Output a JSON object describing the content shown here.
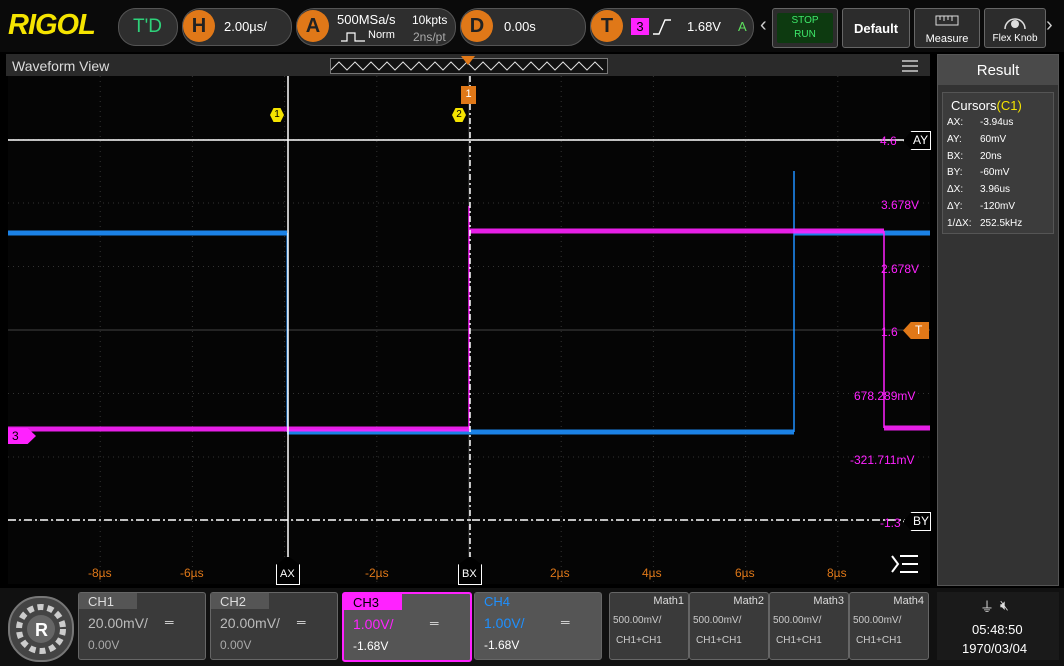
{
  "brand": {
    "logo": "RIGOL"
  },
  "topbar": {
    "trigger_mode": "T'D",
    "horizontal": {
      "icon": "H",
      "value": "2.00µs/"
    },
    "acquire": {
      "icon": "A",
      "sample_rate": "500MSa/s",
      "mode": "Norm",
      "points": "10kpts",
      "per_pt": "2ns/pt"
    },
    "delay": {
      "icon": "D",
      "value": "0.00s"
    },
    "trigger": {
      "icon": "T",
      "channel": "3",
      "level": "1.68V",
      "status": "A"
    },
    "stop_run": {
      "line1": "STOP",
      "line2": "RUN"
    },
    "default_label": "Default",
    "measure_label": "Measure",
    "flex_knob_label": "Flex Knob"
  },
  "waveform": {
    "title": "Waveform View",
    "cursor_ay_label": "AY",
    "cursor_by_label": "BY",
    "cursor_ax_label": "AX",
    "cursor_bx_label": "BX",
    "trigger_marker": "T",
    "ch3_marker": "3",
    "ay_value": "4.6",
    "by_value": "-1.3",
    "t_value": "1.6",
    "marker1": "1",
    "marker2": "2",
    "voltage_labels": [
      "3.678V",
      "2.678V",
      "678.289mV",
      "-321.711mV"
    ],
    "time_labels": [
      "-8µs",
      "-6µs",
      "-2µs",
      "2µs",
      "4µs",
      "6µs",
      "8µs"
    ]
  },
  "result": {
    "title": "Result",
    "cursor_title": "Cursors",
    "cursor_channel": "(C1)",
    "rows": [
      {
        "k": "AX:",
        "v": "-3.94us"
      },
      {
        "k": "AY:",
        "v": "60mV"
      },
      {
        "k": "BX:",
        "v": "20ns"
      },
      {
        "k": "BY:",
        "v": "-60mV"
      },
      {
        "k": "ΔX:",
        "v": "3.96us"
      },
      {
        "k": "ΔY:",
        "v": "-120mV"
      },
      {
        "k": "1/ΔX:",
        "v": "252.5kHz"
      }
    ]
  },
  "channels": [
    {
      "name": "CH1",
      "scale": "20.00mV/",
      "offset": "0.00V"
    },
    {
      "name": "CH2",
      "scale": "20.00mV/",
      "offset": "0.00V"
    },
    {
      "name": "CH3",
      "scale": "1.00V/",
      "offset": "-1.68V"
    },
    {
      "name": "CH4",
      "scale": "1.00V/",
      "offset": "-1.68V"
    }
  ],
  "math": [
    {
      "name": "Math1",
      "scale": "500.00mV/",
      "expr": "CH1+CH1"
    },
    {
      "name": "Math2",
      "scale": "500.00mV/",
      "expr": "CH1+CH1"
    },
    {
      "name": "Math3",
      "scale": "500.00mV/",
      "expr": "CH1+CH1"
    },
    {
      "name": "Math4",
      "scale": "500.00mV/",
      "expr": "CH1+CH1"
    }
  ],
  "status": {
    "time": "05:48:50",
    "date": "1970/03/04"
  },
  "colors": {
    "ch1": "#f5e400",
    "ch2": "#00e0e0",
    "ch3": "#ff22ff",
    "ch4": "#1e90ff",
    "accent": "#e07818"
  }
}
